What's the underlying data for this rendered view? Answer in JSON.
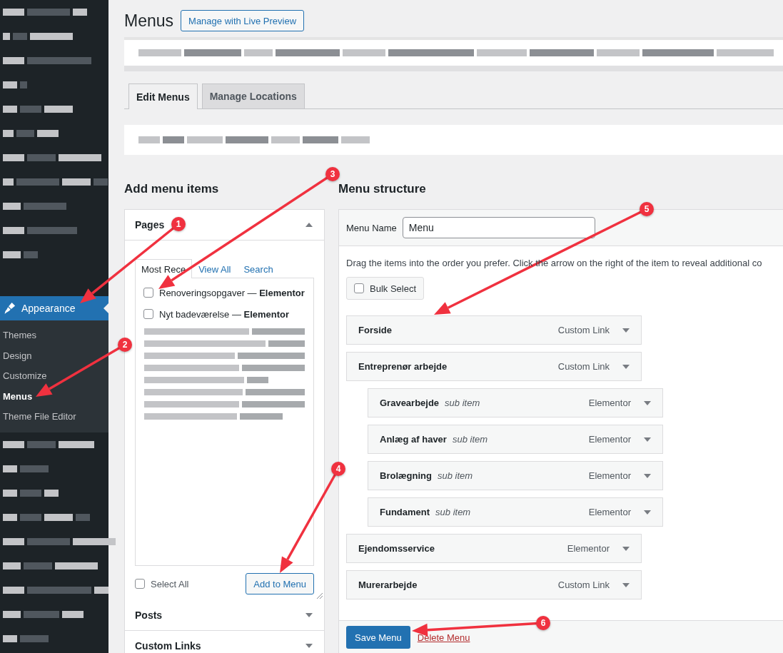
{
  "page_title": "Menus",
  "live_preview_button": "Manage with Live Preview",
  "sidebar": {
    "active_menu": {
      "label": "Appearance",
      "selected": true
    },
    "submenu": [
      {
        "label": "Themes",
        "selected": false
      },
      {
        "label": "Design",
        "selected": false
      },
      {
        "label": "Customize",
        "selected": false
      },
      {
        "label": "Menus",
        "selected": true
      },
      {
        "label": "Theme File Editor",
        "selected": false
      }
    ]
  },
  "tabs": [
    {
      "label": "Edit Menus",
      "selected": true
    },
    {
      "label": "Manage Locations",
      "selected": false
    }
  ],
  "add_items": {
    "heading": "Add menu items",
    "sections": [
      {
        "title": "Pages",
        "expanded": true
      },
      {
        "title": "Posts",
        "expanded": false
      },
      {
        "title": "Custom Links",
        "expanded": false
      }
    ],
    "pages_tabs": [
      {
        "label": "Most Rece",
        "selected": true
      },
      {
        "label": "View All",
        "selected": false
      },
      {
        "label": "Search",
        "selected": false
      }
    ],
    "pages": [
      {
        "label": "Renoveringsopgaver — **Elementor**",
        "checked": false
      },
      {
        "label": "Nyt badeværelse — **Elementor**",
        "checked": false
      }
    ],
    "select_all": {
      "label": "Select All",
      "checked": false
    },
    "add_button": "Add to Menu"
  },
  "structure": {
    "heading": "Menu structure",
    "menu_name_label": "Menu Name",
    "menu_name": "Menu",
    "instructions": "Drag the items into the order you prefer. Click the arrow on the right of the item to reveal additional co",
    "bulk_select": {
      "label": "Bulk Select",
      "checked": false
    },
    "items": [
      {
        "title": "Forside",
        "type": "Custom Link"
      },
      {
        "title": "Entreprenør arbejde",
        "type": "Custom Link",
        "children": [
          {
            "title": "Gravearbejde",
            "note": "sub item",
            "type": "Elementor"
          },
          {
            "title": "Anlæg af haver",
            "note": "sub item",
            "type": "Elementor"
          },
          {
            "title": "Brolægning",
            "note": "sub item",
            "type": "Elementor"
          },
          {
            "title": "Fundament",
            "note": "sub item",
            "type": "Elementor"
          }
        ]
      },
      {
        "title": "Ejendomsservice",
        "type": "Elementor"
      },
      {
        "title": "Murerarbejde",
        "type": "Custom Link"
      }
    ],
    "save_button": "Save Menu",
    "delete_link": "Delete Menu"
  },
  "annotations": [
    {
      "label": "1"
    },
    {
      "label": "2"
    },
    {
      "label": "3"
    },
    {
      "label": "4"
    },
    {
      "label": "5"
    },
    {
      "label": "6"
    }
  ]
}
